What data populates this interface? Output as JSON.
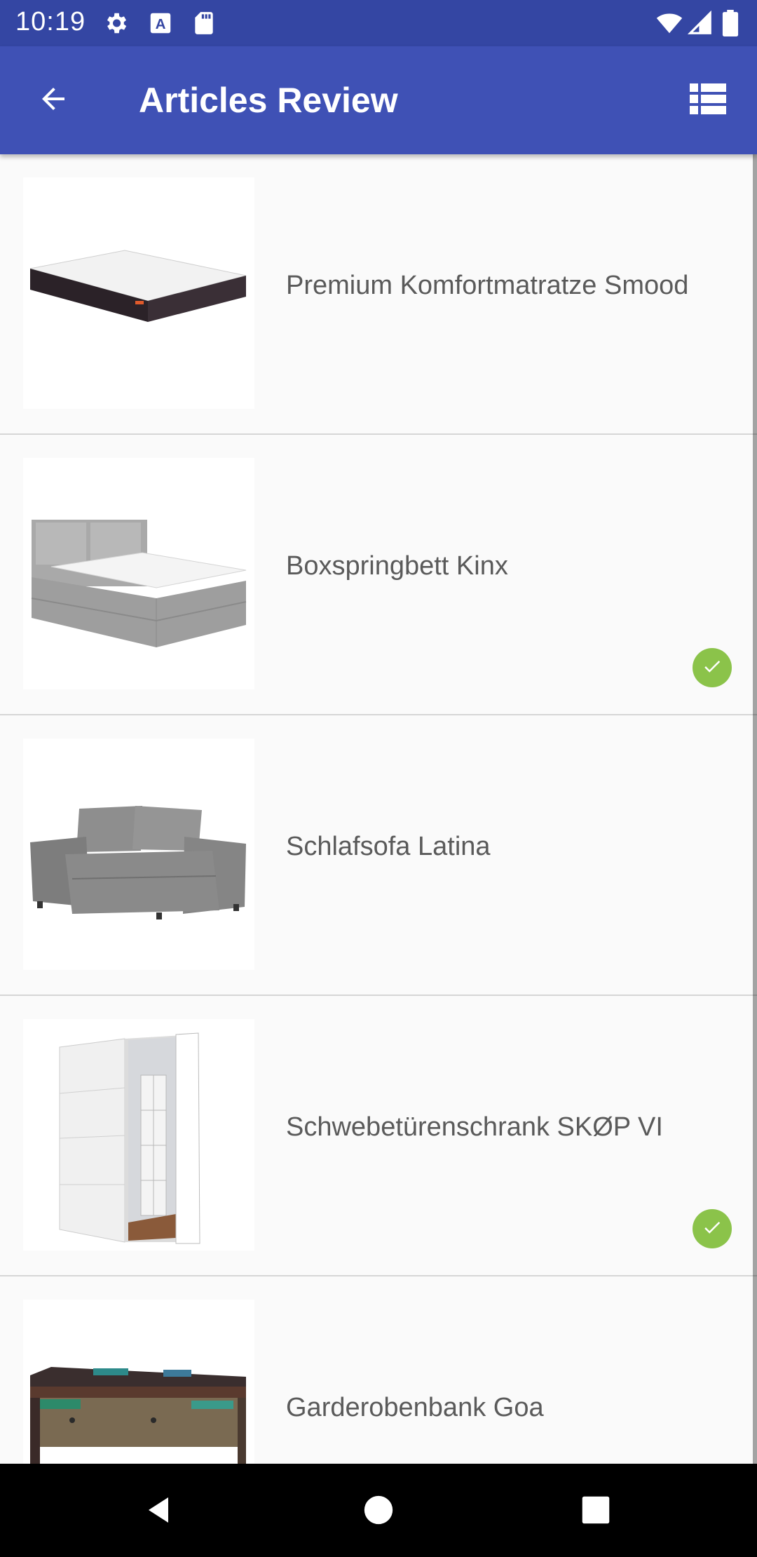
{
  "status_bar": {
    "time": "10:19",
    "left_icons": [
      "settings-icon",
      "keyboard-a-icon",
      "sd-card-icon"
    ],
    "right_icons": [
      "wifi-icon",
      "signal-icon",
      "battery-icon"
    ]
  },
  "app_bar": {
    "title": "Articles Review",
    "back_icon": "arrow-left-icon",
    "action_icon": "view-list-icon"
  },
  "articles": [
    {
      "name": "Premium Komfortmatratze Smood",
      "image": "mattress",
      "reviewed": false
    },
    {
      "name": "Boxspringbett Kinx",
      "image": "boxspring-bed",
      "reviewed": true
    },
    {
      "name": "Schlafsofa Latina",
      "image": "sofa",
      "reviewed": false
    },
    {
      "name": "Schwebetürenschrank SKØP VI",
      "image": "wardrobe",
      "reviewed": true
    },
    {
      "name": "Garderobenbank Goa",
      "image": "bench",
      "reviewed": false
    }
  ],
  "nav_bar": {
    "icons": [
      "back-triangle-icon",
      "home-circle-icon",
      "recents-square-icon"
    ]
  },
  "colors": {
    "status_bar": "#3446a3",
    "app_bar": "#3f51b5",
    "check_badge": "#8bc34a",
    "text": "#5a5a5a"
  }
}
